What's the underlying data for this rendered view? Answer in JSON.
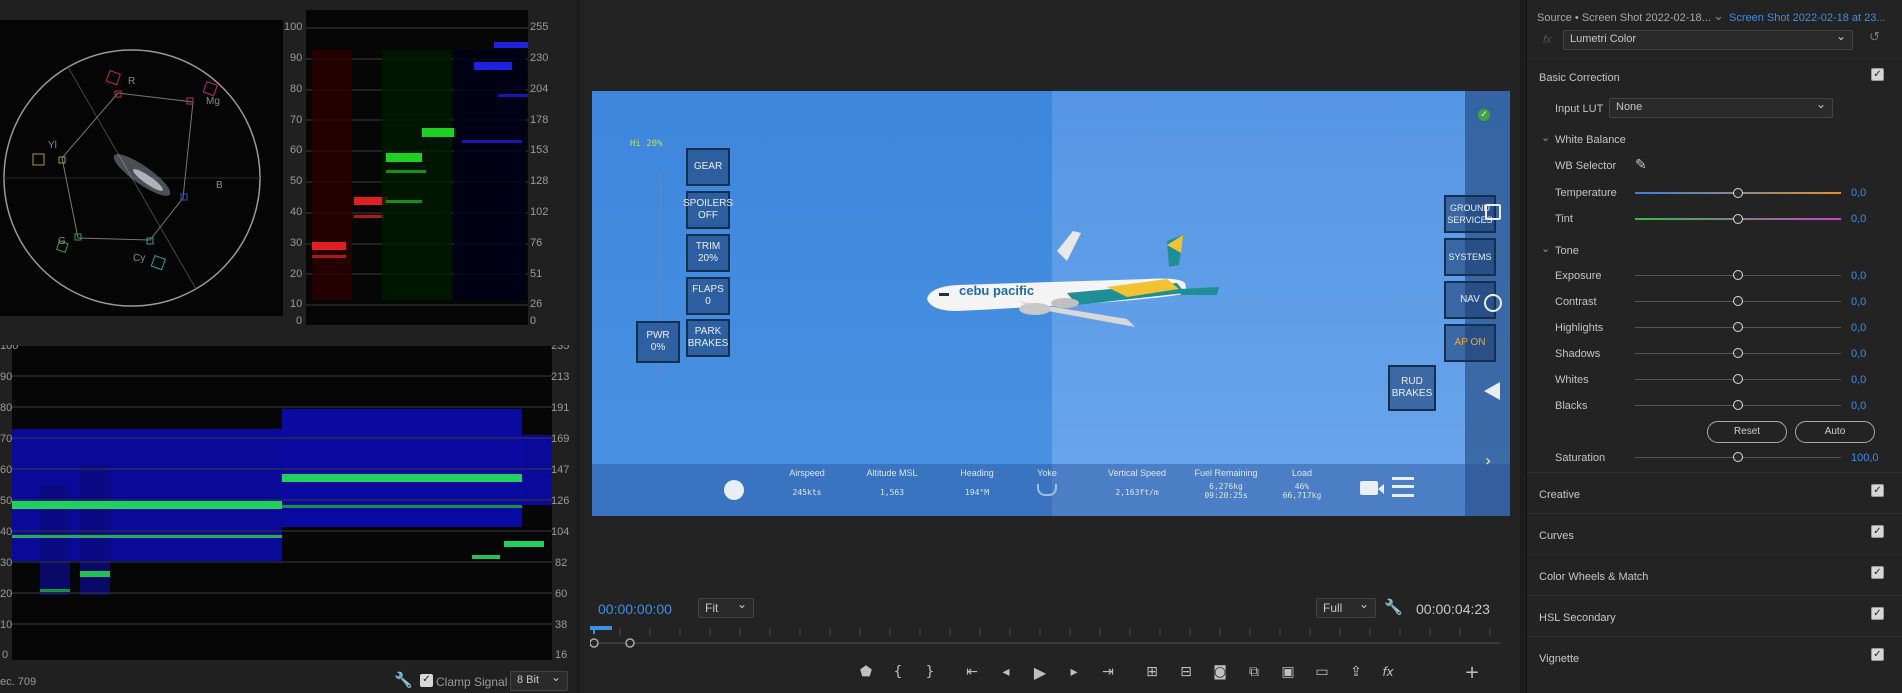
{
  "scopes": {
    "vectorscope_targets": [
      "R",
      "Mg",
      "B",
      "Cy",
      "G",
      "Yl"
    ],
    "parade_axis_left": [
      "100",
      "90",
      "80",
      "70",
      "60",
      "50",
      "40",
      "30",
      "20",
      "10",
      "0"
    ],
    "parade_axis_right": [
      "255",
      "230",
      "204",
      "178",
      "153",
      "128",
      "102",
      "76",
      "51",
      "26",
      "0"
    ],
    "waveform_axis_left": [
      "100",
      "90",
      "80",
      "70",
      "60",
      "50",
      "40",
      "30",
      "20",
      "10",
      "0"
    ],
    "waveform_axis_right": [
      "235",
      "213",
      "191",
      "169",
      "147",
      "126",
      "104",
      "82",
      "60",
      "38",
      "16"
    ],
    "colorspace_label": "ec. 709",
    "clamp_signal_label": "Clamp Signal",
    "clamp_signal_checked": true,
    "bit_depth": "8 Bit"
  },
  "monitor": {
    "timecode_current": "00:00:00:00",
    "zoom": "Fit",
    "resolution": "Full",
    "timecode_duration": "00:00:04:23",
    "transport_icons": [
      "marker-icon",
      "mark-in-icon",
      "mark-out-icon",
      "go-to-in-icon",
      "step-back-icon",
      "play-icon",
      "step-forward-icon",
      "go-to-out-icon",
      "insert-icon",
      "overwrite-icon",
      "export-frame-icon",
      "comparison-view-icon",
      "multi-camera-icon",
      "vr-video-icon",
      "export-icon",
      "fx-icon",
      "add-button-icon"
    ]
  },
  "game": {
    "percent_label": "Hi 20%",
    "buttons_left": [
      "GEAR",
      "SPOILERS OFF",
      "TRIM 20%",
      "FLAPS 0",
      "PARK BRAKES"
    ],
    "power": "PWR 0%",
    "buttons_right": [
      "GROUND SERVICES",
      "SYSTEMS",
      "NAV",
      "AP ON"
    ],
    "rud_brakes": "RUD BRAKES",
    "stats": [
      {
        "label": "Airspeed",
        "value": "245kts"
      },
      {
        "label": "Altitude MSL",
        "value": "1,563"
      },
      {
        "label": "Heading",
        "value": "194°M"
      },
      {
        "label": "Yoke",
        "value": ""
      },
      {
        "label": "Vertical Speed",
        "value": "2,163ft/m"
      },
      {
        "label": "Fuel Remaining",
        "value": "6,276kg 09:20:25s"
      },
      {
        "label": "Load",
        "value": "46% 66,717kg"
      }
    ],
    "aircraft_livery": "cebu pacific"
  },
  "lumetri": {
    "source_label": "Source • Screen Shot 2022-02-18...",
    "clip_label": "Screen Shot 2022-02-18 at 23...",
    "effect": "Lumetri Color",
    "basic_correction": "Basic Correction",
    "input_lut_label": "Input LUT",
    "input_lut_value": "None",
    "white_balance": "White Balance",
    "wb_selector": "WB Selector",
    "sliders_wb": [
      {
        "label": "Temperature",
        "value": "0,0"
      },
      {
        "label": "Tint",
        "value": "0,0"
      }
    ],
    "tone": "Tone",
    "sliders_tone": [
      {
        "label": "Exposure",
        "value": "0,0"
      },
      {
        "label": "Contrast",
        "value": "0,0"
      },
      {
        "label": "Highlights",
        "value": "0,0"
      },
      {
        "label": "Shadows",
        "value": "0,0"
      },
      {
        "label": "Whites",
        "value": "0,0"
      },
      {
        "label": "Blacks",
        "value": "0,0"
      }
    ],
    "reset": "Reset",
    "auto": "Auto",
    "saturation_label": "Saturation",
    "saturation_value": "100,0",
    "sections": [
      "Creative",
      "Curves",
      "Color Wheels & Match",
      "HSL Secondary",
      "Vignette"
    ]
  },
  "colors": {
    "accent_blue": "#3c8fe6",
    "sky": "#4a8fdf",
    "hud_orange": "#f0a830"
  }
}
